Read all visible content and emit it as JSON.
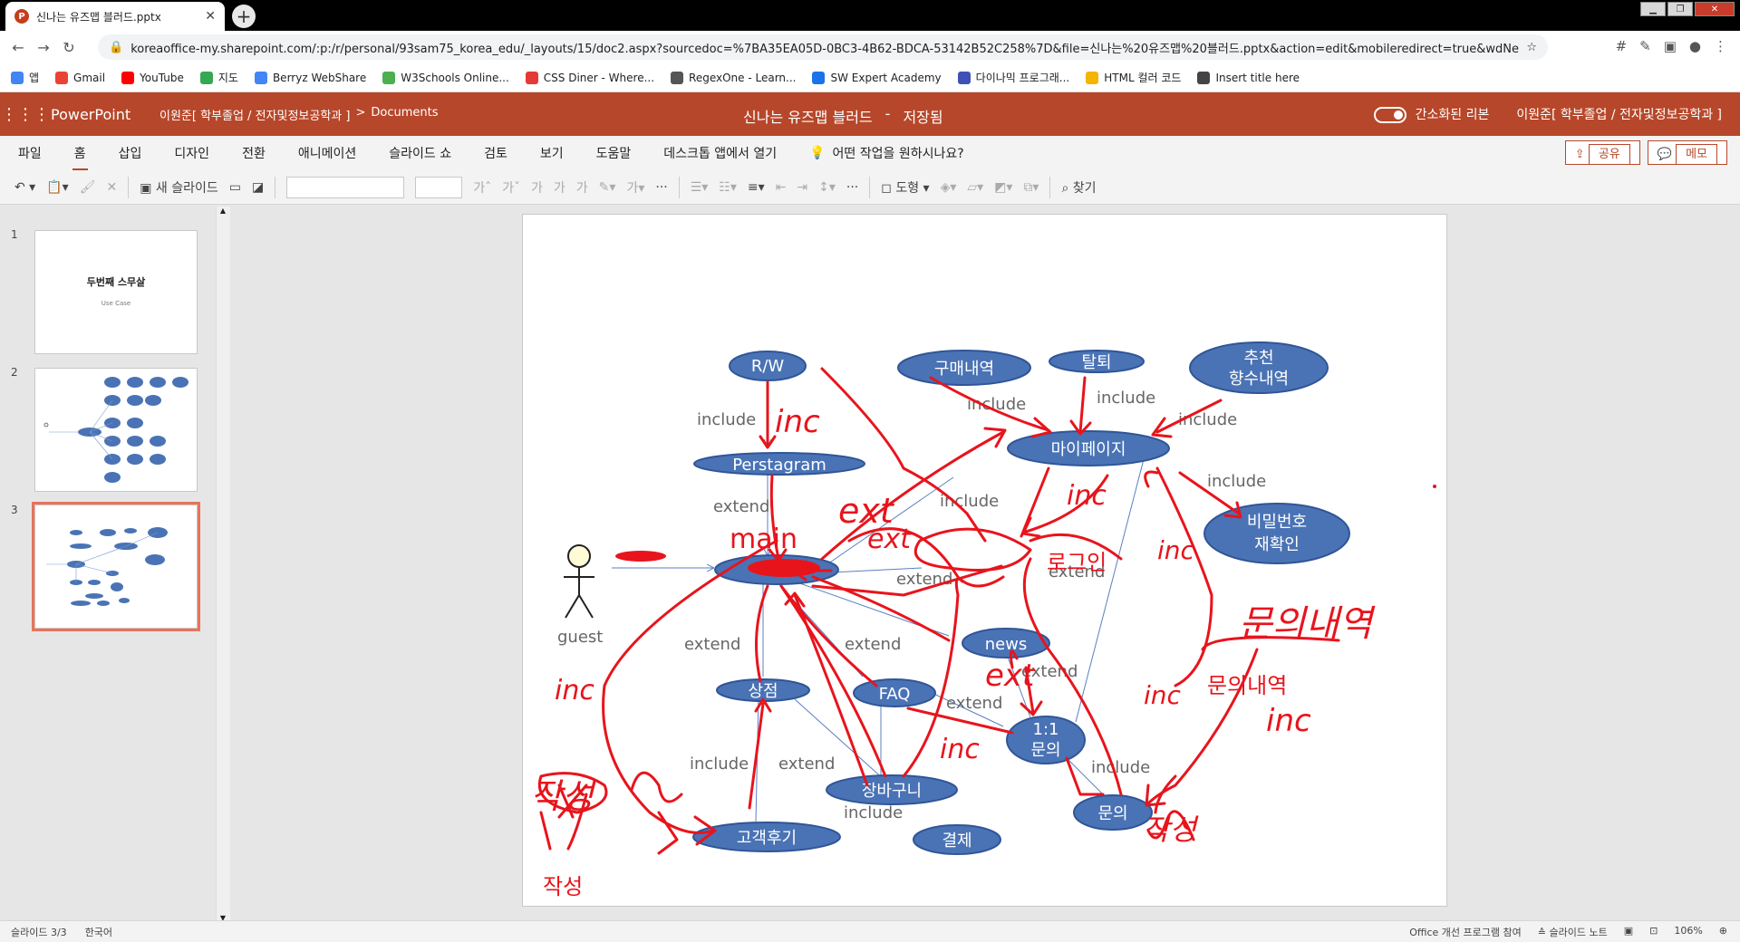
{
  "browser": {
    "tab_title": "신나는 유즈맵 블러드.pptx",
    "url": "koreaoffice-my.sharepoint.com/:p:/r/personal/93sam75_korea_edu/_layouts/15/doc2.aspx?sourcedoc=%7BA35EA05D-0BC3-4B62-BDCA-53142B52C258%7D&file=신나는%20유즈맵%20블러드.pptx&action=edit&mobileredirect=true&wdNewAn...",
    "bookmarks": [
      "앱",
      "Gmail",
      "YouTube",
      "지도",
      "Berryz WebShare",
      "W3Schools Online...",
      "CSS Diner - Where...",
      "RegexOne - Learn...",
      "SW Expert Academy",
      "다이나믹 프로그래...",
      "HTML 컬러 코드",
      "Insert title here"
    ],
    "bookmark_colors": [
      "#4285f4",
      "#ea4335",
      "#ff0000",
      "#34a853",
      "#4285f4",
      "#4caf50",
      "#e53935",
      "#555555",
      "#1a73e8",
      "#3f51b5",
      "#f4b400",
      "#444444"
    ]
  },
  "app": {
    "name": "PowerPoint",
    "breadcrumb_user": "이원준[ 학부졸업 / 전자및정보공학과 ]",
    "breadcrumb_sep": ">",
    "breadcrumb_folder": "Documents",
    "doc_title": "신나는 유즈맵 블러드",
    "doc_sep": "-",
    "save_state": "저장됨",
    "simplified_ribbon": "간소화된 리본",
    "user_name": "이원준[ 학부졸업 / 전자및정보공학과 ]",
    "accent": "#b7472a"
  },
  "menu": {
    "items": [
      "파일",
      "홈",
      "삽입",
      "디자인",
      "전환",
      "애니메이션",
      "슬라이드 쇼",
      "검토",
      "보기",
      "도움말",
      "데스크톱 앱에서 열기"
    ],
    "active": "홈",
    "tell_me": "어떤 작업을 원하시나요?",
    "share": "공유",
    "comment": "메모"
  },
  "toolbar": {
    "new_slide": "새 슬라이드",
    "shapes": "도형",
    "find": "찾기"
  },
  "thumbnails": [
    {
      "num": "1",
      "title": "두번째 스무살",
      "subtitle": "Use Case"
    },
    {
      "num": "2"
    },
    {
      "num": "3"
    }
  ],
  "diagram": {
    "actor": "guest",
    "nodes": {
      "rw": "R/W",
      "purchase": "구매내역",
      "withdraw": "탈퇴",
      "recommend1": "추천",
      "recommend2": "향수내역",
      "perstagram": "Perstagram",
      "mypage": "마이페이지",
      "pwcheck1": "비밀번호",
      "pwcheck2": "재확인",
      "news": "news",
      "shop": "상점",
      "faq": "FAQ",
      "inquiry1": "1:1",
      "inquiry2": "문의",
      "cart": "장바구니",
      "review": "고객후기",
      "pay": "결제",
      "ask": "문의"
    },
    "edge_labels": {
      "include": "include",
      "extend": "extend"
    },
    "handwritten": {
      "login": "로그인",
      "inquiry_list": "문의내역",
      "write": "작성",
      "main": "main",
      "ext": "ext",
      "inc": "inc"
    }
  },
  "status": {
    "slide": "슬라이드 3/3",
    "lang": "한국어",
    "improve": "Office 개선 프로그램 참여",
    "notes": "슬라이드 노트",
    "zoom": "106%"
  }
}
